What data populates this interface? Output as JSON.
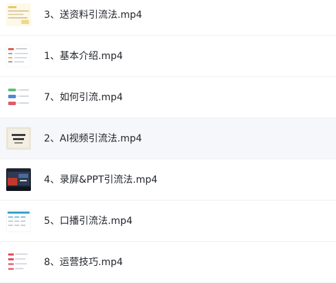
{
  "files": [
    {
      "name": "3、送资料引流法.mp4",
      "thumb_icon": "video-thumbnail-icon"
    },
    {
      "name": "1、基本介绍.mp4",
      "thumb_icon": "video-thumbnail-icon"
    },
    {
      "name": "7、如何引流.mp4",
      "thumb_icon": "video-thumbnail-icon"
    },
    {
      "name": "2、AI视频引流法.mp4",
      "thumb_icon": "video-thumbnail-icon",
      "selected": true
    },
    {
      "name": "4、录屏&PPT引流法.mp4",
      "thumb_icon": "video-thumbnail-icon"
    },
    {
      "name": "5、口播引流法.mp4",
      "thumb_icon": "video-thumbnail-icon"
    },
    {
      "name": "8、运营技巧.mp4",
      "thumb_icon": "video-thumbnail-icon"
    }
  ],
  "colors": {
    "text": "#1f2329",
    "row_divider": "#eef0f3",
    "selected_row_bg": "#f5f7fb"
  }
}
